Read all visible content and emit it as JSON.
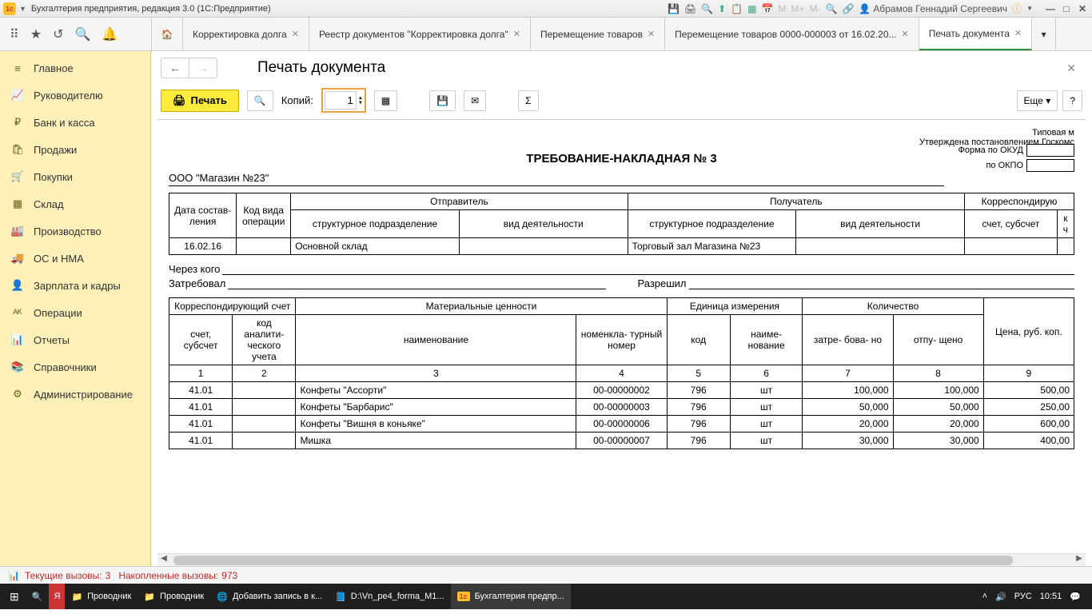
{
  "titlebar": {
    "title": "Бухгалтерия предприятия, редакция 3.0  (1С:Предприятие)",
    "user": "Абрамов Геннадий Сергеевич",
    "m_labels": [
      "M",
      "M+",
      "M-"
    ]
  },
  "tabs": [
    {
      "label": "Корректировка долга"
    },
    {
      "label": "Реестр документов \"Корректировка долга\""
    },
    {
      "label": "Перемещение товаров"
    },
    {
      "label": "Перемещение товаров 0000-000003 от 16.02.20..."
    },
    {
      "label": "Печать документа",
      "active": true
    }
  ],
  "sidebar": [
    {
      "icon": "≡",
      "label": "Главное"
    },
    {
      "icon": "📈",
      "label": "Руководителю"
    },
    {
      "icon": "₽",
      "label": "Банк и касса"
    },
    {
      "icon": "🛍",
      "label": "Продажи"
    },
    {
      "icon": "🛒",
      "label": "Покупки"
    },
    {
      "icon": "▦",
      "label": "Склад"
    },
    {
      "icon": "🏭",
      "label": "Производство"
    },
    {
      "icon": "🚚",
      "label": "ОС и НМА"
    },
    {
      "icon": "👤",
      "label": "Зарплата и кадры"
    },
    {
      "icon": "ᴬᴷ",
      "label": "Операции"
    },
    {
      "icon": "📊",
      "label": "Отчеты"
    },
    {
      "icon": "📚",
      "label": "Справочники"
    },
    {
      "icon": "⚙",
      "label": "Администрирование"
    }
  ],
  "page": {
    "title": "Печать документа",
    "print_label": "Печать",
    "copies_label": "Копий:",
    "copies_value": "1",
    "more_label": "Еще",
    "help_label": "?"
  },
  "doc": {
    "form_type": "Типовая м",
    "approved": "Утверждена постановлением Госкомс",
    "okud_label": "Форма по ОКУД",
    "okpo_label": "по ОКПО",
    "title": "ТРЕБОВАНИЕ-НАКЛАДНАЯ № 3",
    "org": "ООО \"Магазин №23\"",
    "through_label": "Через кого",
    "requested_label": "Затребовал",
    "permitted_label": "Разрешил",
    "headers1": {
      "date": "Дата состав-\nления",
      "op_code": "Код вида операции",
      "sender": "Отправитель",
      "receiver": "Получатель",
      "corr": "Корреспондирую",
      "struct": "структурное\nподразделение",
      "activity": "вид\nдеятельности",
      "account": "счет, субсчет",
      "kch": "к\nч"
    },
    "row1": {
      "date": "16.02.16",
      "sender_struct": "Основной склад",
      "receiver_struct": "Торговый зал Магазина №23"
    },
    "headers2": {
      "corr_account": "Корреспондирующий счет",
      "materials": "Материальные ценности",
      "unit": "Единица\nизмерения",
      "qty": "Количество",
      "price": "Цена,\nруб. коп.",
      "account_sub": "счет,\nсубсчет",
      "analytic": "код\nаналити-\nческого\nучета",
      "name": "наименование",
      "nomenclature": "номенкла-\nтурный номер",
      "code": "код",
      "unit_name": "наиме-\nнование",
      "requested": "затре-\nбова-\nно",
      "released": "отпу-\nщено"
    },
    "col_nums": [
      "1",
      "2",
      "3",
      "4",
      "5",
      "6",
      "7",
      "8",
      "9"
    ],
    "items": [
      {
        "acc": "41.01",
        "name": "Конфеты \"Ассорти\"",
        "nom": "00-00000002",
        "code": "796",
        "unit": "шт",
        "req": "100,000",
        "rel": "100,000",
        "price": "500,00"
      },
      {
        "acc": "41.01",
        "name": "Конфеты \"Барбарис\"",
        "nom": "00-00000003",
        "code": "796",
        "unit": "шт",
        "req": "50,000",
        "rel": "50,000",
        "price": "250,00"
      },
      {
        "acc": "41.01",
        "name": "Конфеты \"Вишня в коньяке\"",
        "nom": "00-00000006",
        "code": "796",
        "unit": "шт",
        "req": "20,000",
        "rel": "20,000",
        "price": "600,00"
      },
      {
        "acc": "41.01",
        "name": "Мишка",
        "nom": "00-00000007",
        "code": "796",
        "unit": "шт",
        "req": "30,000",
        "rel": "30,000",
        "price": "400,00"
      }
    ]
  },
  "status": {
    "current_label": "Текущие вызовы:",
    "current_value": "3",
    "accumulated_label": "Накопленные вызовы:",
    "accumulated_value": "973"
  },
  "taskbar": {
    "items": [
      {
        "icon": "📁",
        "label": "Проводник"
      },
      {
        "icon": "📁",
        "label": "Проводник"
      },
      {
        "icon": "🌐",
        "label": "Добавить запись в к..."
      },
      {
        "icon": "📘",
        "label": "D:\\Vn_pe4_forma_M1..."
      },
      {
        "icon": "1c",
        "label": "Бухгалтерия предпр...",
        "active": true
      }
    ],
    "lang": "РУС",
    "time": "10:51"
  }
}
